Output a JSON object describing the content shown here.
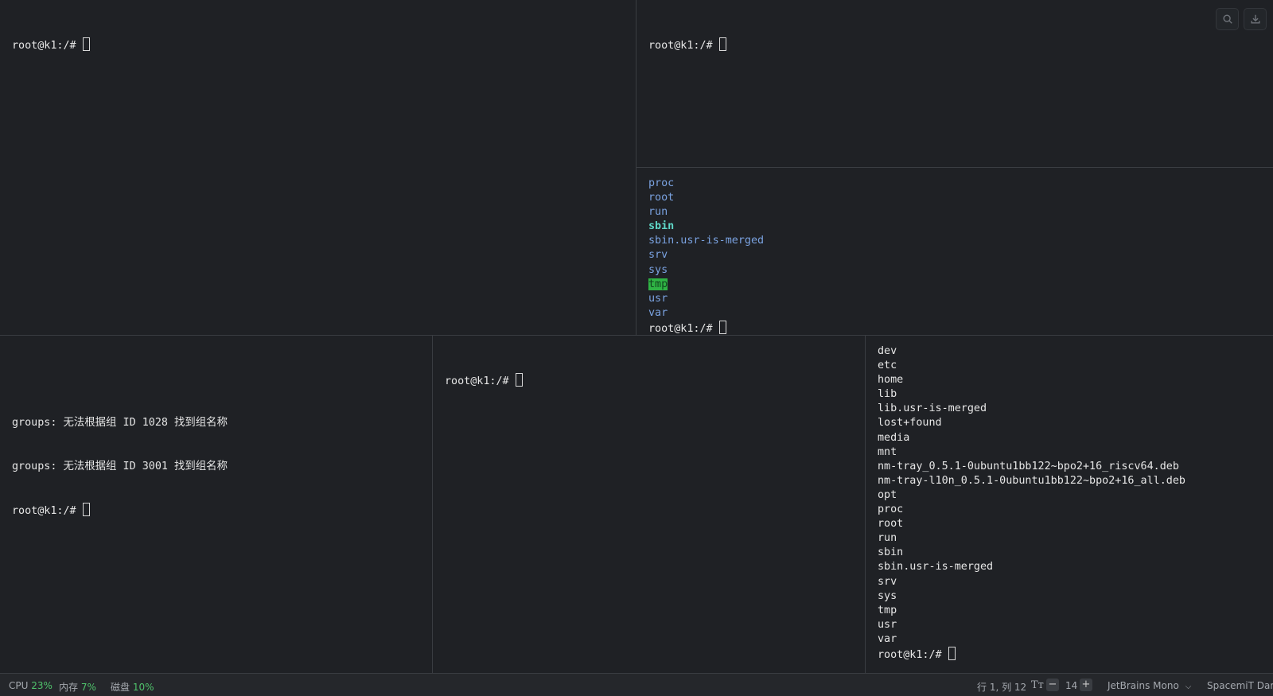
{
  "colors": {
    "background": "#1f2125",
    "dir": "#7aa2e0",
    "dir_bold": "#5fd7c7",
    "highlight": "#2fb344",
    "status_green": "#4fc26b"
  },
  "panes": {
    "top_left": {
      "lines": [
        "root@k1:/#"
      ]
    },
    "top_right_upper": {
      "lines": [
        "root@k1:/#"
      ]
    },
    "top_right_lower": {
      "entries": [
        {
          "text": "proc",
          "style": "dir"
        },
        {
          "text": "root",
          "style": "dir"
        },
        {
          "text": "run",
          "style": "dir"
        },
        {
          "text": "sbin",
          "style": "dir-bold"
        },
        {
          "text": "sbin.usr-is-merged",
          "style": "dir"
        },
        {
          "text": "srv",
          "style": "dir"
        },
        {
          "text": "sys",
          "style": "dir"
        },
        {
          "text": "tmp",
          "style": "hl"
        },
        {
          "text": "usr",
          "style": "dir"
        },
        {
          "text": "var",
          "style": "dir"
        }
      ],
      "prompt": "root@k1:/#"
    },
    "bottom_left": {
      "lines": [
        "",
        "groups: 无法根据组 ID 1028 找到组名称",
        "groups: 无法根据组 ID 3001 找到组名称"
      ],
      "prompt": "root@k1:/#"
    },
    "bottom_middle": {
      "prompt": "root@k1:/#"
    },
    "bottom_right": {
      "lines": [
        "dev",
        "etc",
        "home",
        "lib",
        "lib.usr-is-merged",
        "lost+found",
        "media",
        "mnt",
        "nm-tray_0.5.1-0ubuntu1bb122~bpo2+16_riscv64.deb",
        "nm-tray-l10n_0.5.1-0ubuntu1bb122~bpo2+16_all.deb",
        "opt",
        "proc",
        "root",
        "run",
        "sbin",
        "sbin.usr-is-merged",
        "srv",
        "sys",
        "tmp",
        "usr",
        "var"
      ],
      "prompt": "root@k1:/#"
    }
  },
  "toolbar": {
    "search_icon": "search-icon",
    "download_icon": "download-icon"
  },
  "status": {
    "cpu_label": "CPU",
    "cpu_value": "23%",
    "mem_label": "内存",
    "mem_value": "7%",
    "disk_label": "磁盘",
    "disk_value": "10%",
    "position": "行 1, 列 12",
    "font_size_icon": "Tт",
    "minus": "−",
    "font_size": "14",
    "plus": "+",
    "font": "JetBrains Mono",
    "theme": "SpacemiT Dark"
  }
}
